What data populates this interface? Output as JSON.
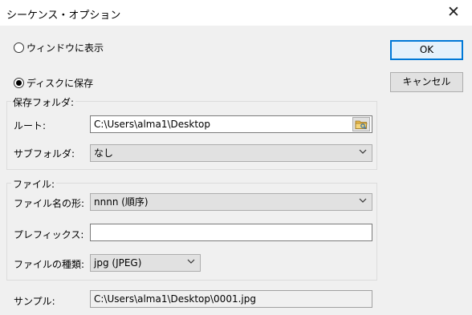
{
  "window": {
    "title": "シーケンス・オプション",
    "close_glyph": "✕"
  },
  "output": {
    "window_option": "ウィンドウに表示",
    "disk_option": "ディスクに保存",
    "selected": "disk"
  },
  "save_folder": {
    "group_title": "保存フォルダ:",
    "root_label": "ルート:",
    "root_value": "C:\\Users\\alma1\\Desktop",
    "subfolder_label": "サブフォルダ:",
    "subfolder_value": "なし"
  },
  "file": {
    "group_title": "ファイル:",
    "name_format_label": "ファイル名の形:",
    "name_format_value": "nnnn (順序)",
    "prefix_label": "プレフィックス:",
    "prefix_value": "",
    "type_label": "ファイルの種類:",
    "type_value": "jpg (JPEG)"
  },
  "sample": {
    "label": "サンプル:",
    "value": "C:\\Users\\alma1\\Desktop\\0001.jpg"
  },
  "buttons": {
    "ok": "OK",
    "cancel": "キャンセル"
  },
  "icons": {
    "browse": "folder-browse-icon",
    "dropdown": "chevron-down-icon"
  }
}
